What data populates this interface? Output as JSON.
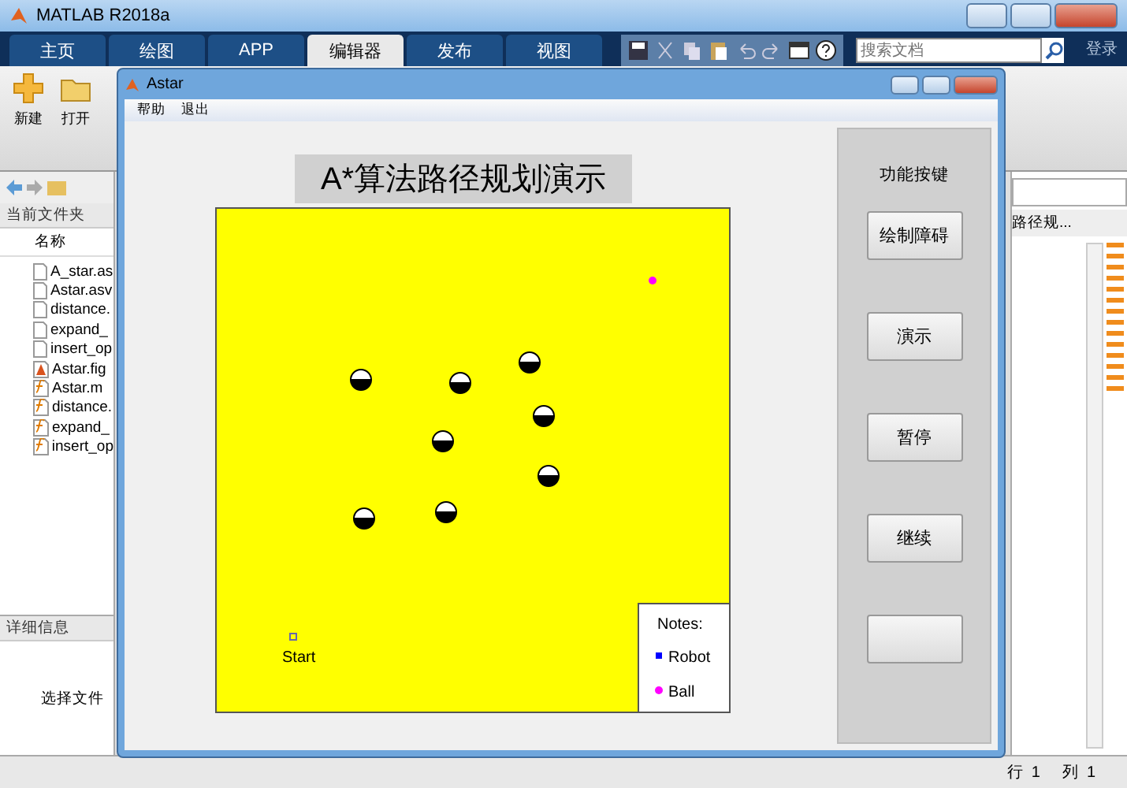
{
  "main_window": {
    "title": "MATLAB R2018a"
  },
  "ribbon_tabs": [
    {
      "label": "主页",
      "selected": false
    },
    {
      "label": "绘图",
      "selected": false
    },
    {
      "label": "APP",
      "selected": false
    },
    {
      "label": "编辑器",
      "selected": true
    },
    {
      "label": "发布",
      "selected": false
    },
    {
      "label": "视图",
      "selected": false
    }
  ],
  "search": {
    "placeholder": "搜索文档"
  },
  "login": "登录",
  "toolstrip_buttons": [
    {
      "label": "新建",
      "kind": "new"
    },
    {
      "label": "打开",
      "kind": "open"
    }
  ],
  "current_folder": {
    "title": "当前文件夹",
    "column": "名称",
    "files": [
      {
        "name": "A_star.as",
        "kind": "doc"
      },
      {
        "name": "Astar.asv",
        "kind": "doc"
      },
      {
        "name": "distance.",
        "kind": "doc"
      },
      {
        "name": "expand_",
        "kind": "doc"
      },
      {
        "name": "insert_op",
        "kind": "doc"
      },
      {
        "name": "Astar.fig",
        "kind": "fig"
      },
      {
        "name": "Astar.m",
        "kind": "func"
      },
      {
        "name": "distance.",
        "kind": "func"
      },
      {
        "name": "expand_",
        "kind": "func"
      },
      {
        "name": "insert_op",
        "kind": "func"
      }
    ]
  },
  "details": {
    "title": "详细信息",
    "message": "选择文件"
  },
  "editor": {
    "tab": "路径规..."
  },
  "status_bar": {
    "row_label": "行",
    "row": "1",
    "col_label": "列",
    "col": "1"
  },
  "astar_window": {
    "title": "Astar",
    "menu": [
      "帮助",
      "退出"
    ],
    "plot_title": "A*算法路径规划演示",
    "start_label": "Start",
    "legend": {
      "title": "Notes:",
      "items": [
        {
          "label": "Robot",
          "kind": "square",
          "color": "#0000ff"
        },
        {
          "label": "Ball",
          "kind": "circle",
          "color": "#ff00ff"
        }
      ]
    },
    "panel": {
      "title": "功能按键",
      "buttons": [
        "绘制障碍",
        "演示",
        "暂停",
        "继续"
      ]
    }
  }
}
